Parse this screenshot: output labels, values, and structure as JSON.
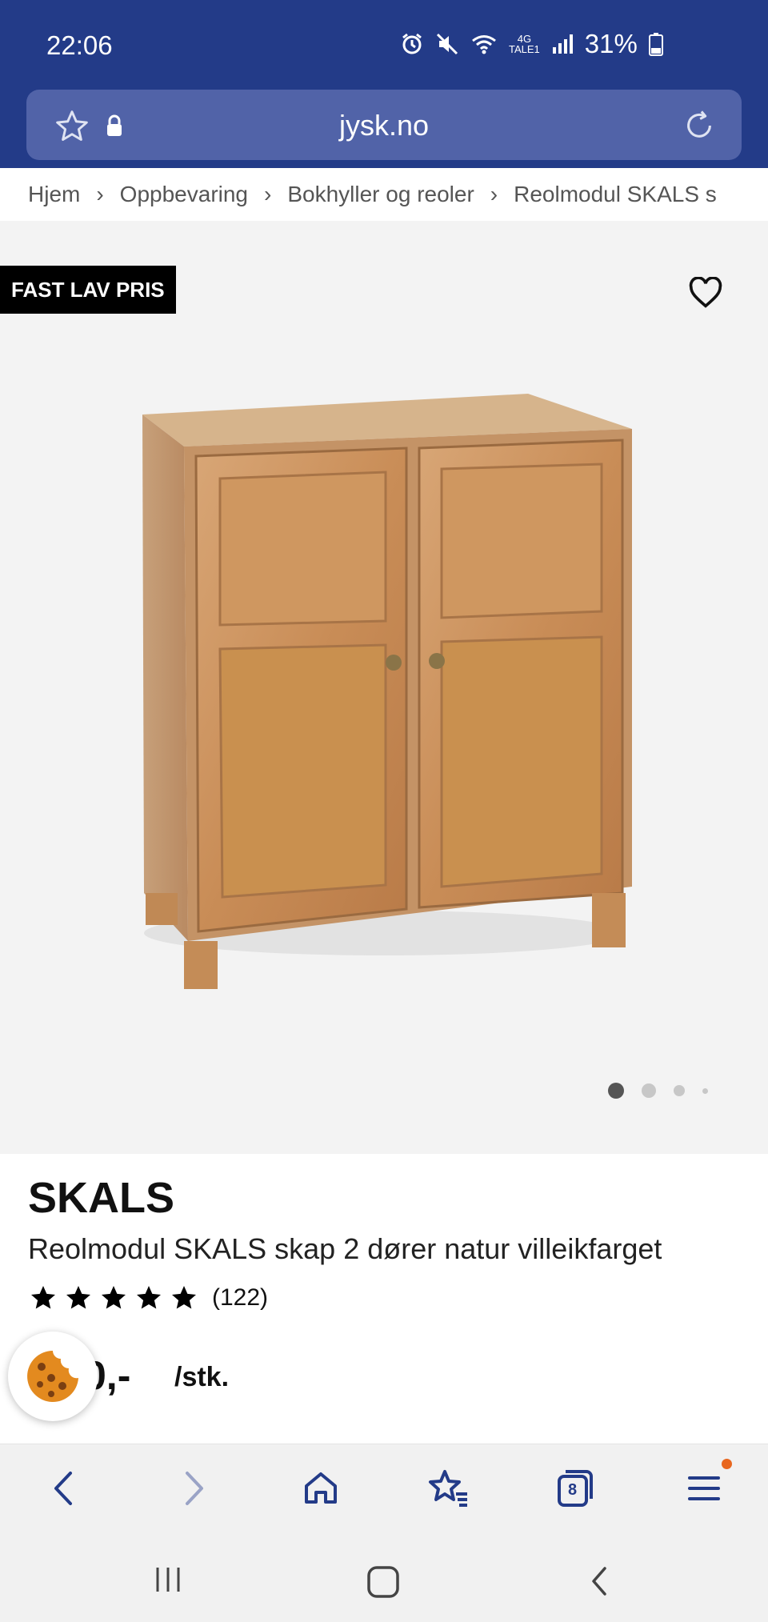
{
  "status": {
    "time": "22:06",
    "battery_pct": "31%",
    "net_top": "4G",
    "net_bottom": "TALE1",
    "icons": [
      "alarm-icon",
      "mute-icon",
      "wifi-icon",
      "signal-icon",
      "battery-icon"
    ]
  },
  "browser": {
    "url": "jysk.no",
    "tabs_count": "8",
    "colors": {
      "header": "#233b88",
      "urlbar": "#5163a8",
      "notify": "#e8671f"
    }
  },
  "breadcrumb": {
    "items": [
      "Hjem",
      "Oppbevaring",
      "Bokhyller og reoler",
      "Reolmodul SKALS s"
    ],
    "separator": "›"
  },
  "gallery": {
    "badge": "FAST LAV PRIS",
    "image_count": 4,
    "active_index": 0
  },
  "product": {
    "brand": "SKALS",
    "name": "Reolmodul SKALS skap 2 dører natur villeikfarget",
    "rating_stars": 5,
    "rating_count": "(122)",
    "price_visible": "0,-",
    "unit": "/stk."
  }
}
